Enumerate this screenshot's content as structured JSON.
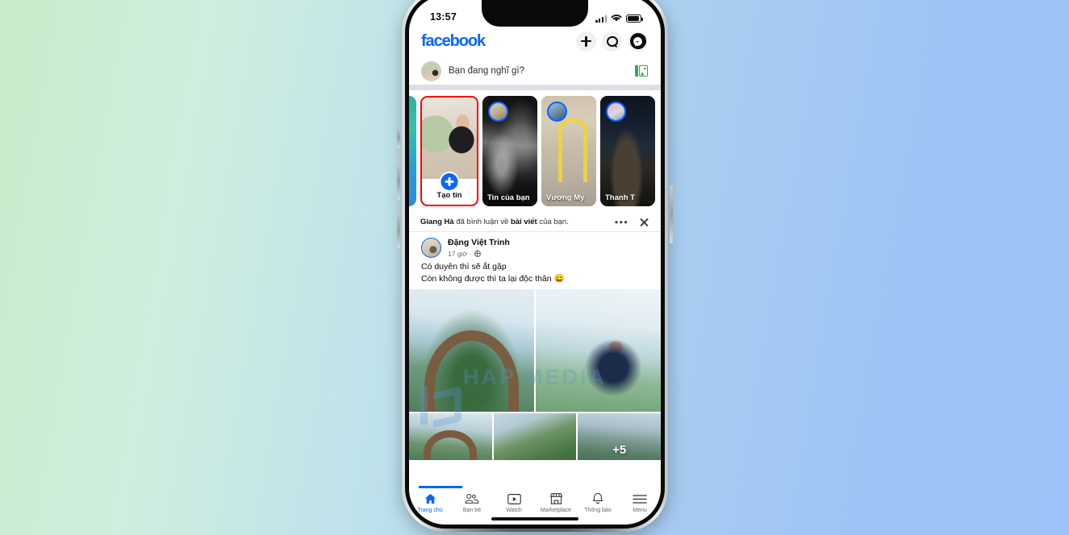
{
  "status_bar": {
    "time": "13:57",
    "signal_icon": "cellular-signal-icon",
    "wifi_icon": "wifi-icon",
    "battery_icon": "battery-icon"
  },
  "header": {
    "logo": "facebook",
    "brand_color": "#0866FF",
    "actions": [
      {
        "name": "create-button",
        "icon": "plus-icon"
      },
      {
        "name": "search-button",
        "icon": "search-icon"
      },
      {
        "name": "messenger-button",
        "icon": "messenger-icon"
      }
    ]
  },
  "composer": {
    "placeholder": "Bạn đang nghĩ gì?",
    "avatar": "user-avatar",
    "photo_icon": "photo-gallery-icon"
  },
  "stories": {
    "create": {
      "label": "Tạo tin",
      "highlight_color": "#FF0000",
      "plus_icon": "plus-icon"
    },
    "items": [
      {
        "name": "Tin của bạn"
      },
      {
        "name": "Vương My"
      },
      {
        "name": "Thanh T"
      }
    ]
  },
  "notification": {
    "text_prefix": "Giang Hà",
    "text_middle": " đã bình luận về ",
    "text_bold2": "bài viết",
    "text_suffix": " của bạn.",
    "menu_icon": "more-options-icon",
    "close_icon": "close-icon"
  },
  "post": {
    "author": "Đặng Việt Trinh",
    "time": "17 giờ",
    "separator": "·",
    "privacy_icon": "globe-public-icon",
    "body_line1": "Có duyên thì sẽ ắt gặp",
    "body_line2": "Còn không được thì ta lại độc thân 😄",
    "gallery_more": "+5",
    "watermark": "HAP MEDIA"
  },
  "bottom_nav": {
    "items": [
      {
        "label": "Trang chủ",
        "icon": "home-icon",
        "active": true
      },
      {
        "label": "Bạn bè",
        "icon": "friends-icon",
        "active": false
      },
      {
        "label": "Watch",
        "icon": "watch-video-icon",
        "active": false
      },
      {
        "label": "Marketplace",
        "icon": "marketplace-store-icon",
        "active": false
      },
      {
        "label": "Thông báo",
        "icon": "bell-notification-icon",
        "active": false
      },
      {
        "label": "Menu",
        "icon": "hamburger-menu-icon",
        "active": false
      }
    ],
    "active_color": "#0866FF"
  }
}
